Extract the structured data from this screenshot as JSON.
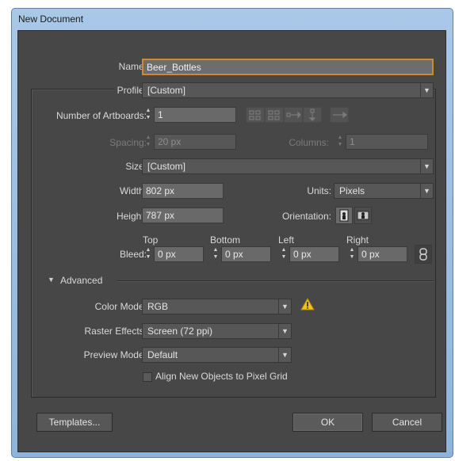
{
  "window": {
    "title": "New Document"
  },
  "form": {
    "name_label": "Name:",
    "name_value": "Beer_Bottles",
    "profile_label": "Profile:",
    "profile_value": "[Custom]",
    "artboards_label": "Number of Artboards:",
    "artboards_value": "1",
    "spacing_label": "Spacing:",
    "spacing_value": "20 px",
    "columns_label": "Columns:",
    "columns_value": "1",
    "size_label": "Size:",
    "size_value": "[Custom]",
    "width_label": "Width:",
    "width_value": "802 px",
    "units_label": "Units:",
    "units_value": "Pixels",
    "height_label": "Height:",
    "height_value": "787 px",
    "orientation_label": "Orientation:",
    "bleed_label": "Bleed:",
    "bleed": [
      {
        "label": "Top",
        "value": "0 px"
      },
      {
        "label": "Bottom",
        "value": "0 px"
      },
      {
        "label": "Left",
        "value": "0 px"
      },
      {
        "label": "Right",
        "value": "0 px"
      }
    ],
    "advanced_label": "Advanced",
    "color_mode_label": "Color Mode:",
    "color_mode_value": "RGB",
    "raster_label": "Raster Effects:",
    "raster_value": "Screen (72 ppi)",
    "preview_label": "Preview Mode:",
    "preview_value": "Default",
    "align_label": "Align New Objects to Pixel Grid"
  },
  "buttons": {
    "templates": "Templates...",
    "ok": "OK",
    "cancel": "Cancel"
  },
  "icons": {
    "warning": "warning-icon",
    "link": "link-icon",
    "portrait": "portrait-orientation-icon",
    "landscape": "landscape-orientation-icon"
  },
  "colors": {
    "dialog_bg": "#474747",
    "focus_ring": "#d08a2c",
    "warning": "#f2c31b"
  }
}
